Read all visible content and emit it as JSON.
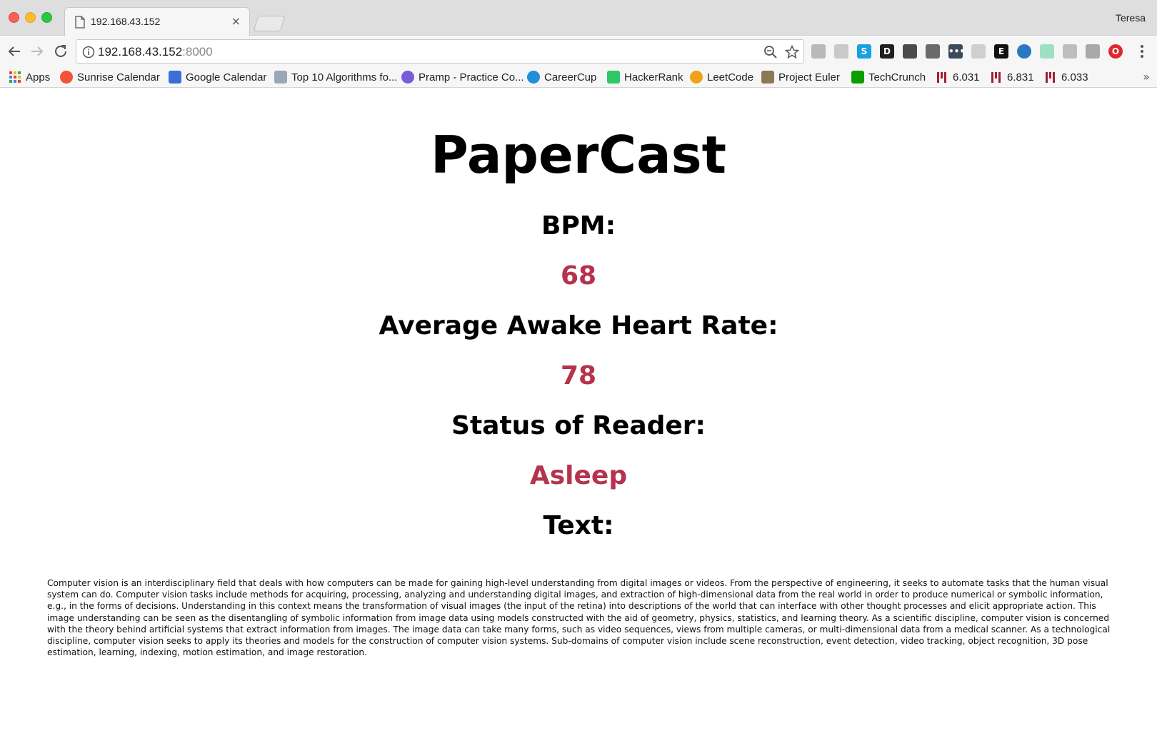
{
  "window": {
    "profile_name": "Teresa"
  },
  "tab": {
    "title": "192.168.43.152",
    "close_glyph": "×"
  },
  "omnibox": {
    "host": "192.168.43.152",
    "port": ":8000"
  },
  "bookmarks": [
    {
      "label": "Apps",
      "icon": "apps-grid-icon",
      "color": "#4285f4"
    },
    {
      "label": "Sunrise Calendar",
      "icon": "sunrise-calendar-icon",
      "color": "#f4523b"
    },
    {
      "label": "Google Calendar",
      "icon": "google-calendar-icon",
      "color": "#3b6fd6"
    },
    {
      "label": "Top 10 Algorithms fo...",
      "icon": "mountain-icon",
      "color": "#9aa7b4"
    },
    {
      "label": "Pramp - Practice Co...",
      "icon": "pramp-check-icon",
      "color": "#7b5cd6"
    },
    {
      "label": "CareerCup",
      "icon": "careercup-icon",
      "color": "#1f8fd8"
    },
    {
      "label": "HackerRank",
      "icon": "hackerrank-icon",
      "color": "#2ec866"
    },
    {
      "label": "LeetCode",
      "icon": "leetcode-icon",
      "color": "#f0a21a"
    },
    {
      "label": "Project Euler",
      "icon": "project-euler-icon",
      "color": "#8a7a52"
    },
    {
      "label": "TechCrunch",
      "icon": "techcrunch-icon",
      "color": "#0a9e01"
    },
    {
      "label": "6.031",
      "icon": "mit-icon",
      "color": "#a31f34"
    },
    {
      "label": "6.831",
      "icon": "mit-icon",
      "color": "#a31f34"
    },
    {
      "label": "6.033",
      "icon": "mit-icon",
      "color": "#a31f34"
    }
  ],
  "extensions": [
    {
      "name": "ghost-extension-icon",
      "color": "#b9b9b9",
      "glyph": ""
    },
    {
      "name": "rss-extension-icon",
      "color": "#c9c9c9",
      "glyph": ""
    },
    {
      "name": "skype-extension-icon",
      "color": "#1aa1e1",
      "glyph": "S"
    },
    {
      "name": "dashlane-extension-icon",
      "color": "#1f1f1f",
      "glyph": "D"
    },
    {
      "name": "pocket-extension-icon",
      "color": "#4a4a4a",
      "glyph": ""
    },
    {
      "name": "cast-extension-icon",
      "color": "#6a6a6a",
      "glyph": ""
    },
    {
      "name": "dots-extension-icon",
      "color": "#3a4a5a",
      "glyph": "•••"
    },
    {
      "name": "gray-extension-icon",
      "color": "#cfcfcf",
      "glyph": ""
    },
    {
      "name": "evernote-extension-icon",
      "color": "#111111",
      "glyph": "E"
    },
    {
      "name": "eye-extension-icon",
      "color": "#2a78c2",
      "glyph": ""
    },
    {
      "name": "audio-extension-icon",
      "color": "#9fe0c2",
      "glyph": ""
    },
    {
      "name": "inbox-extension-icon",
      "color": "#bdbdbd",
      "glyph": ""
    },
    {
      "name": "clipboard-extension-icon",
      "color": "#a9a9a9",
      "glyph": ""
    },
    {
      "name": "opera-extension-icon",
      "color": "#e0262e",
      "glyph": "O"
    }
  ],
  "page": {
    "title": "PaperCast",
    "bpm_label": "BPM:",
    "bpm_value": "68",
    "avg_label": "Average Awake Heart Rate:",
    "avg_value": "78",
    "status_label": "Status of Reader:",
    "status_value": "Asleep",
    "text_label": "Text:",
    "text_body": "Computer vision is an interdisciplinary field that deals with how computers can be made for gaining high-level understanding from digital images or videos. From the perspective of engineering, it seeks to automate tasks that the human visual system can do. Computer vision tasks include methods for acquiring, processing, analyzing and understanding digital images, and extraction of high-dimensional data from the real world in order to produce numerical or symbolic information, e.g., in the forms of decisions. Understanding in this context means the transformation of visual images (the input of the retina) into descriptions of the world that can interface with other thought processes and elicit appropriate action. This image understanding can be seen as the disentangling of symbolic information from image data using models constructed with the aid of geometry, physics, statistics, and learning theory. As a scientific discipline, computer vision is concerned with the theory behind artificial systems that extract information from images. The image data can take many forms, such as video sequences, views from multiple cameras, or multi-dimensional data from a medical scanner. As a technological discipline, computer vision seeks to apply its theories and models for the construction of computer vision systems. Sub-domains of computer vision include scene reconstruction, event detection, video tracking, object recognition, 3D pose estimation, learning, indexing, motion estimation, and image restoration."
  },
  "colors": {
    "accent_value": "#b5334d"
  }
}
